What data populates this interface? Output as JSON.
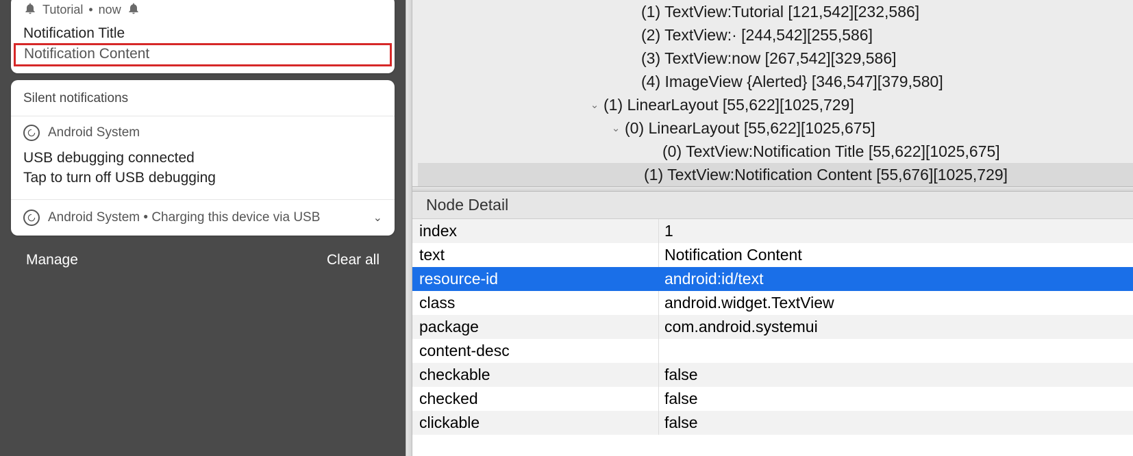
{
  "device": {
    "notif": {
      "app": "Tutorial",
      "dot": "•",
      "time": "now",
      "title": "Notification Title",
      "content": "Notification Content"
    },
    "silent": {
      "header": "Silent notifications",
      "system1_app": "Android System",
      "system1_line1": "USB debugging connected",
      "system1_line2": "Tap to turn off USB debugging",
      "system2_text": "Android System  •  Charging this device via USB"
    },
    "actions": {
      "manage": "Manage",
      "clear": "Clear all"
    }
  },
  "tree": [
    {
      "indent": "ind-0",
      "disclosure": "",
      "text": "(1) TextView:Tutorial [121,542][232,586]",
      "selected": false
    },
    {
      "indent": "ind-0",
      "disclosure": "",
      "text": "(2) TextView:· [244,542][255,586]",
      "selected": false
    },
    {
      "indent": "ind-0",
      "disclosure": "",
      "text": "(3) TextView:now [267,542][329,586]",
      "selected": false
    },
    {
      "indent": "ind-0",
      "disclosure": "",
      "text": "(4) ImageView {Alerted} [346,547][379,580]",
      "selected": false
    },
    {
      "indent": "ind-1",
      "disclosure": "v",
      "text": "(1) LinearLayout [55,622][1025,729]",
      "selected": false
    },
    {
      "indent": "ind-2",
      "disclosure": "v",
      "text": "(0) LinearLayout [55,622][1025,675]",
      "selected": false
    },
    {
      "indent": "ind-3",
      "disclosure": "",
      "text": "(0) TextView:Notification Title [55,622][1025,675]",
      "selected": false
    },
    {
      "indent": "ind-3b",
      "disclosure": "",
      "text": "(1) TextView:Notification Content [55,676][1025,729]",
      "selected": true
    }
  ],
  "detail": {
    "header": "Node Detail",
    "rows": [
      {
        "key": "index",
        "val": "1",
        "sel": false
      },
      {
        "key": "text",
        "val": "Notification Content",
        "sel": false
      },
      {
        "key": "resource-id",
        "val": "android:id/text",
        "sel": true
      },
      {
        "key": "class",
        "val": "android.widget.TextView",
        "sel": false
      },
      {
        "key": "package",
        "val": "com.android.systemui",
        "sel": false
      },
      {
        "key": "content-desc",
        "val": "",
        "sel": false
      },
      {
        "key": "checkable",
        "val": "false",
        "sel": false
      },
      {
        "key": "checked",
        "val": "false",
        "sel": false
      },
      {
        "key": "clickable",
        "val": "false",
        "sel": false
      }
    ]
  }
}
